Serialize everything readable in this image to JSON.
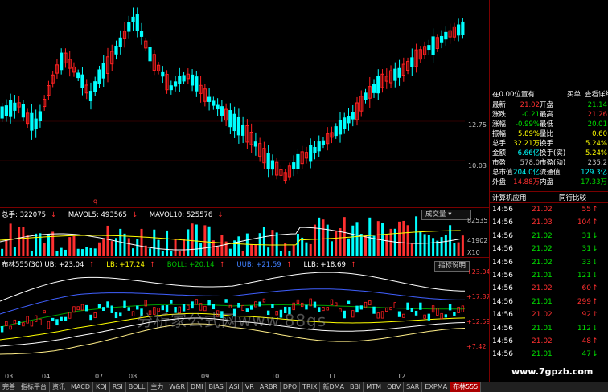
{
  "main_axis": [
    "12.75",
    "10.03"
  ],
  "main_low_marker": "q",
  "volume": {
    "header": [
      {
        "text": "总手: 322075",
        "arrow": "↓",
        "color": "#ffffff"
      },
      {
        "text": "MAVOL5: 493565",
        "arrow": "↓",
        "color": "#ffffff"
      },
      {
        "text": "MAVOL10: 525576",
        "arrow": "↓",
        "color": "#ffff00"
      }
    ],
    "button": "成交量",
    "axis": [
      "82535",
      "41902",
      "X10"
    ]
  },
  "indicator": {
    "header": [
      {
        "text": "布林555(30) UB: +23.04",
        "arrow": "↑",
        "color": "#ffffff"
      },
      {
        "text": "LB: +17.24",
        "arrow": "↑",
        "color": "#ffff00"
      },
      {
        "text": "BOLL: +20.14",
        "arrow": "↑",
        "color": "#00c000"
      },
      {
        "text": "UUB: +21.59",
        "arrow": "↑",
        "color": "#4080ff"
      },
      {
        "text": "LLB: +18.69",
        "arrow": "↑",
        "color": "#ffffff"
      }
    ],
    "button": "指标说明",
    "axis": [
      "+23.04",
      "+17.87",
      "+12.59",
      "+7.42"
    ]
  },
  "x_axis": [
    "03",
    "04",
    "07",
    "08",
    "09",
    "10",
    "11",
    "12"
  ],
  "tabs": [
    "完善",
    "指标平台",
    "资讯",
    "MACD",
    "KDJ",
    "RSI",
    "BOLL",
    "主力",
    "W&R",
    "DMI",
    "BIAS",
    "ASI",
    "VR",
    "ARBR",
    "DPO",
    "TRIX",
    "新DMA",
    "BBI",
    "MTM",
    "OBV",
    "SAR",
    "EXPMA",
    "布林555"
  ],
  "active_tab": "布林555",
  "watermark": "分析家公式网www.88gs",
  "site": "www.7gpzb.com",
  "quote": {
    "top_left": "在0.00位置有",
    "top_right": "买单",
    "top_right2": "查看详细",
    "rows": [
      {
        "l1": "最新",
        "v1": "21.02",
        "c1": "red",
        "l2": "开盘",
        "v2": "21.14",
        "c2": "green"
      },
      {
        "l1": "涨跌",
        "v1": "-0.21",
        "c1": "green",
        "l2": "最高",
        "v2": "21.26",
        "c2": "red"
      },
      {
        "l1": "涨幅",
        "v1": "-0.99%",
        "c1": "green",
        "l2": "最低",
        "v2": "20.01",
        "c2": "green"
      },
      {
        "l1": "振幅",
        "v1": "5.89%",
        "c1": "yellow",
        "l2": "量比",
        "v2": "0.60",
        "c2": "yellow"
      },
      {
        "l1": "总手",
        "v1": "32.21万",
        "c1": "yellow",
        "l2": "换手",
        "v2": "5.24%",
        "c2": "yellow"
      },
      {
        "l1": "金额",
        "v1": "6.66亿",
        "c1": "cyan",
        "l2": "换手(实)",
        "v2": "5.24%",
        "c2": "yellow"
      },
      {
        "l1": "市盈",
        "v1": "578.0",
        "c1": "grey",
        "l2": "市盈(动)",
        "v2": "235.2",
        "c2": "grey"
      },
      {
        "l1": "总市值",
        "v1": "204.0亿",
        "c1": "cyan",
        "l2": "流通值",
        "v2": "129.3亿",
        "c2": "cyan"
      },
      {
        "l1": "外盘",
        "v1": "14.88万",
        "c1": "red",
        "l2": "内盘",
        "v2": "17.33万",
        "c2": "green"
      }
    ],
    "industry": "计算机应用",
    "industry_btn": "同行比较"
  },
  "ticks": [
    {
      "time": "14:56",
      "price": "21.02",
      "pc": "red",
      "vol": "55",
      "vc": "red",
      "dir": "↑"
    },
    {
      "time": "14:56",
      "price": "21.03",
      "pc": "red",
      "vol": "104",
      "vc": "red",
      "dir": "↑"
    },
    {
      "time": "14:56",
      "price": "21.02",
      "pc": "green",
      "vol": "31",
      "vc": "green",
      "dir": "↓"
    },
    {
      "time": "14:56",
      "price": "21.02",
      "pc": "green",
      "vol": "31",
      "vc": "green",
      "dir": "↓"
    },
    {
      "time": "14:56",
      "price": "21.02",
      "pc": "green",
      "vol": "33",
      "vc": "green",
      "dir": "↓"
    },
    {
      "time": "14:56",
      "price": "21.01",
      "pc": "green",
      "vol": "121",
      "vc": "green",
      "dir": "↓"
    },
    {
      "time": "14:56",
      "price": "21.02",
      "pc": "red",
      "vol": "60",
      "vc": "red",
      "dir": "↑"
    },
    {
      "time": "14:56",
      "price": "21.01",
      "pc": "green",
      "vol": "299",
      "vc": "red",
      "dir": "↑"
    },
    {
      "time": "14:56",
      "price": "21.02",
      "pc": "red",
      "vol": "92",
      "vc": "red",
      "dir": "↑"
    },
    {
      "time": "14:56",
      "price": "21.01",
      "pc": "green",
      "vol": "112",
      "vc": "green",
      "dir": "↓"
    },
    {
      "time": "14:56",
      "price": "21.02",
      "pc": "red",
      "vol": "48",
      "vc": "red",
      "dir": "↑"
    },
    {
      "time": "14:56",
      "price": "21.01",
      "pc": "green",
      "vol": "47",
      "vc": "green",
      "dir": "↓"
    }
  ]
}
